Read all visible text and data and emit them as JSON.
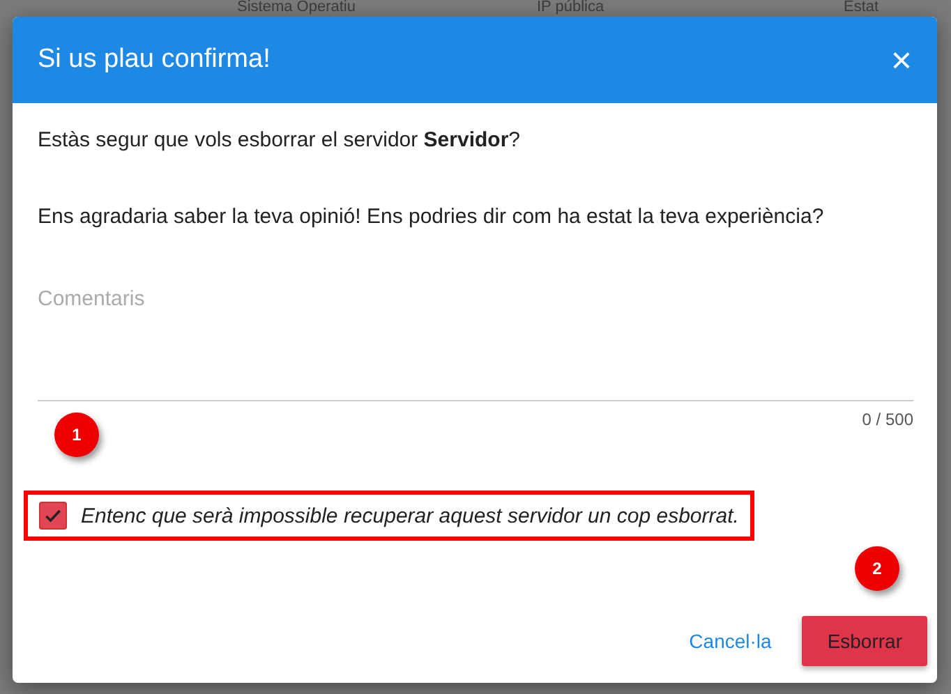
{
  "background": {
    "columns": [
      "Sistema Operatiu",
      "IP pública",
      "Estat"
    ]
  },
  "dialog": {
    "title": "Si us plau confirma!",
    "close": "×",
    "question": "Estàs segur que vols esborrar el servidor **Servidor**?",
    "feedback": "Ens agradaria saber la teva opinió! Ens podries dir com ha estat la teva experiència?",
    "comment": {
      "placeholder": "Comentaris",
      "counter": "0 / 500"
    },
    "confirm": {
      "label": "Entenc que serà impossible recuperar aquest servidor un cop esborrat.",
      "checked": true
    },
    "buttons": [
      {
        "kind": "text",
        "label": "Cancel·la"
      },
      {
        "kind": "danger",
        "label": "Esborrar"
      }
    ]
  },
  "annotations": [
    {
      "label": "1"
    },
    {
      "label": "2"
    }
  ]
}
